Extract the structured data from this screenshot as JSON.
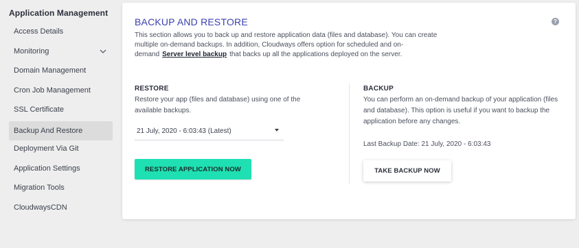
{
  "sidebar": {
    "title": "Application Management",
    "items": [
      {
        "label": "Access Details"
      },
      {
        "label": "Monitoring"
      },
      {
        "label": "Domain Management"
      },
      {
        "label": "Cron Job Management"
      },
      {
        "label": "SSL Certificate"
      },
      {
        "label": "Backup And Restore",
        "active": true
      },
      {
        "label": "Deployment Via Git"
      },
      {
        "label": "Application Settings"
      },
      {
        "label": "Migration Tools"
      },
      {
        "label": "CloudwaysCDN"
      }
    ]
  },
  "main": {
    "title": "BACKUP AND RESTORE",
    "help_icon": "?",
    "description_before": "This section allows you to back up and restore application data (files and database). You can create multiple on-demand backups. In addition, Cloudways offers option for scheduled and on-demand",
    "description_link": "Server level backup",
    "description_after": "that backs up all the applications deployed on the server.",
    "restore": {
      "title": "RESTORE",
      "text": "Restore your app (files and database) using one of the available backups.",
      "selected_backup": "21 July, 2020 - 6:03:43 (Latest)",
      "button": "RESTORE APPLICATION NOW"
    },
    "backup": {
      "title": "BACKUP",
      "text": "You can perform an on-demand backup of your application (files and database). This option is useful if you want to backup the application before any changes.",
      "last_backup": "Last Backup Date: 21 July, 2020 - 6:03:43",
      "button": "TAKE BACKUP NOW"
    }
  },
  "colors": {
    "accent_title": "#3a3fae",
    "restore_button": "#1fe0b2",
    "active_nav": "#dcdcdc"
  }
}
